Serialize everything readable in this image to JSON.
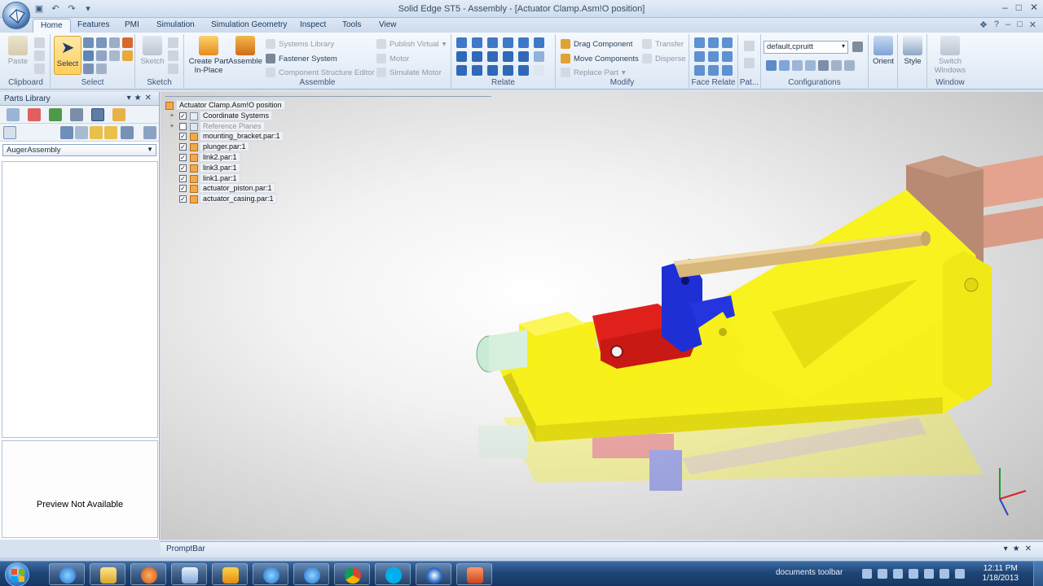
{
  "window": {
    "title": "Solid Edge ST5 - Assembly - [Actuator Clamp.Asm!O position]"
  },
  "tabs": [
    "Home",
    "Features",
    "PMI",
    "Simulation",
    "Simulation Geometry",
    "Inspect",
    "Tools",
    "View"
  ],
  "ribbon": {
    "clipboard": {
      "label": "Clipboard",
      "paste": "Paste"
    },
    "select": {
      "label": "Select",
      "select_btn": "Select"
    },
    "sketch": {
      "label": "Sketch",
      "sketch_btn": "Sketch"
    },
    "assemble": {
      "label": "Assemble",
      "create_part": "Create Part",
      "in_place": "In-Place",
      "assemble_btn": "Assemble",
      "systems_library": "Systems Library",
      "fastener_system": "Fastener System",
      "component_structure_editor": "Component Structure Editor",
      "publish_virtual": "Publish Virtual",
      "motor": "Motor",
      "simulate_motor": "Simulate Motor"
    },
    "relate": {
      "label": "Relate"
    },
    "modify": {
      "label": "Modify",
      "drag_component": "Drag Component",
      "move_components": "Move Components",
      "replace_part": "Replace Part",
      "transfer": "Transfer",
      "disperse": "Disperse"
    },
    "face_relate": {
      "label": "Face Relate"
    },
    "pat": {
      "label": "Pat..."
    },
    "configurations": {
      "label": "Configurations",
      "combo_value": "default,cpruitt"
    },
    "orient": {
      "label": "Orient"
    },
    "style": {
      "label": "Style"
    },
    "window": {
      "label": "Window",
      "switch": "Switch",
      "windows": "Windows"
    }
  },
  "parts_library": {
    "title": "Parts Library",
    "folder": "AugerAssembly",
    "preview_text": "Preview Not Available"
  },
  "tree": {
    "root": "Actuator Clamp.Asm!O position",
    "items": [
      {
        "label": "Coordinate Systems",
        "checked": true
      },
      {
        "label": "Reference Planes",
        "checked": false
      },
      {
        "label": "mounting_bracket.par:1",
        "checked": true
      },
      {
        "label": "plunger.par:1",
        "checked": true
      },
      {
        "label": "link2.par:1",
        "checked": true
      },
      {
        "label": "link3.par:1",
        "checked": true
      },
      {
        "label": "link1.par:1",
        "checked": true
      },
      {
        "label": "actuator_piston.par:1",
        "checked": true
      },
      {
        "label": "actuator_casing.par:1",
        "checked": true
      }
    ]
  },
  "promptbar": {
    "label": "PromptBar"
  },
  "taskbar": {
    "tray_label": "documents toolbar",
    "time": "12:11 PM",
    "date": "1/18/2013"
  },
  "colors": {
    "bracket_yellow": "#f7f01a",
    "link_red": "#e0211b",
    "link_blue": "#1f2fd6",
    "rod_tan": "#d7b77a",
    "piston_mint": "#c9ead3",
    "block_brown": "#b88a73"
  }
}
